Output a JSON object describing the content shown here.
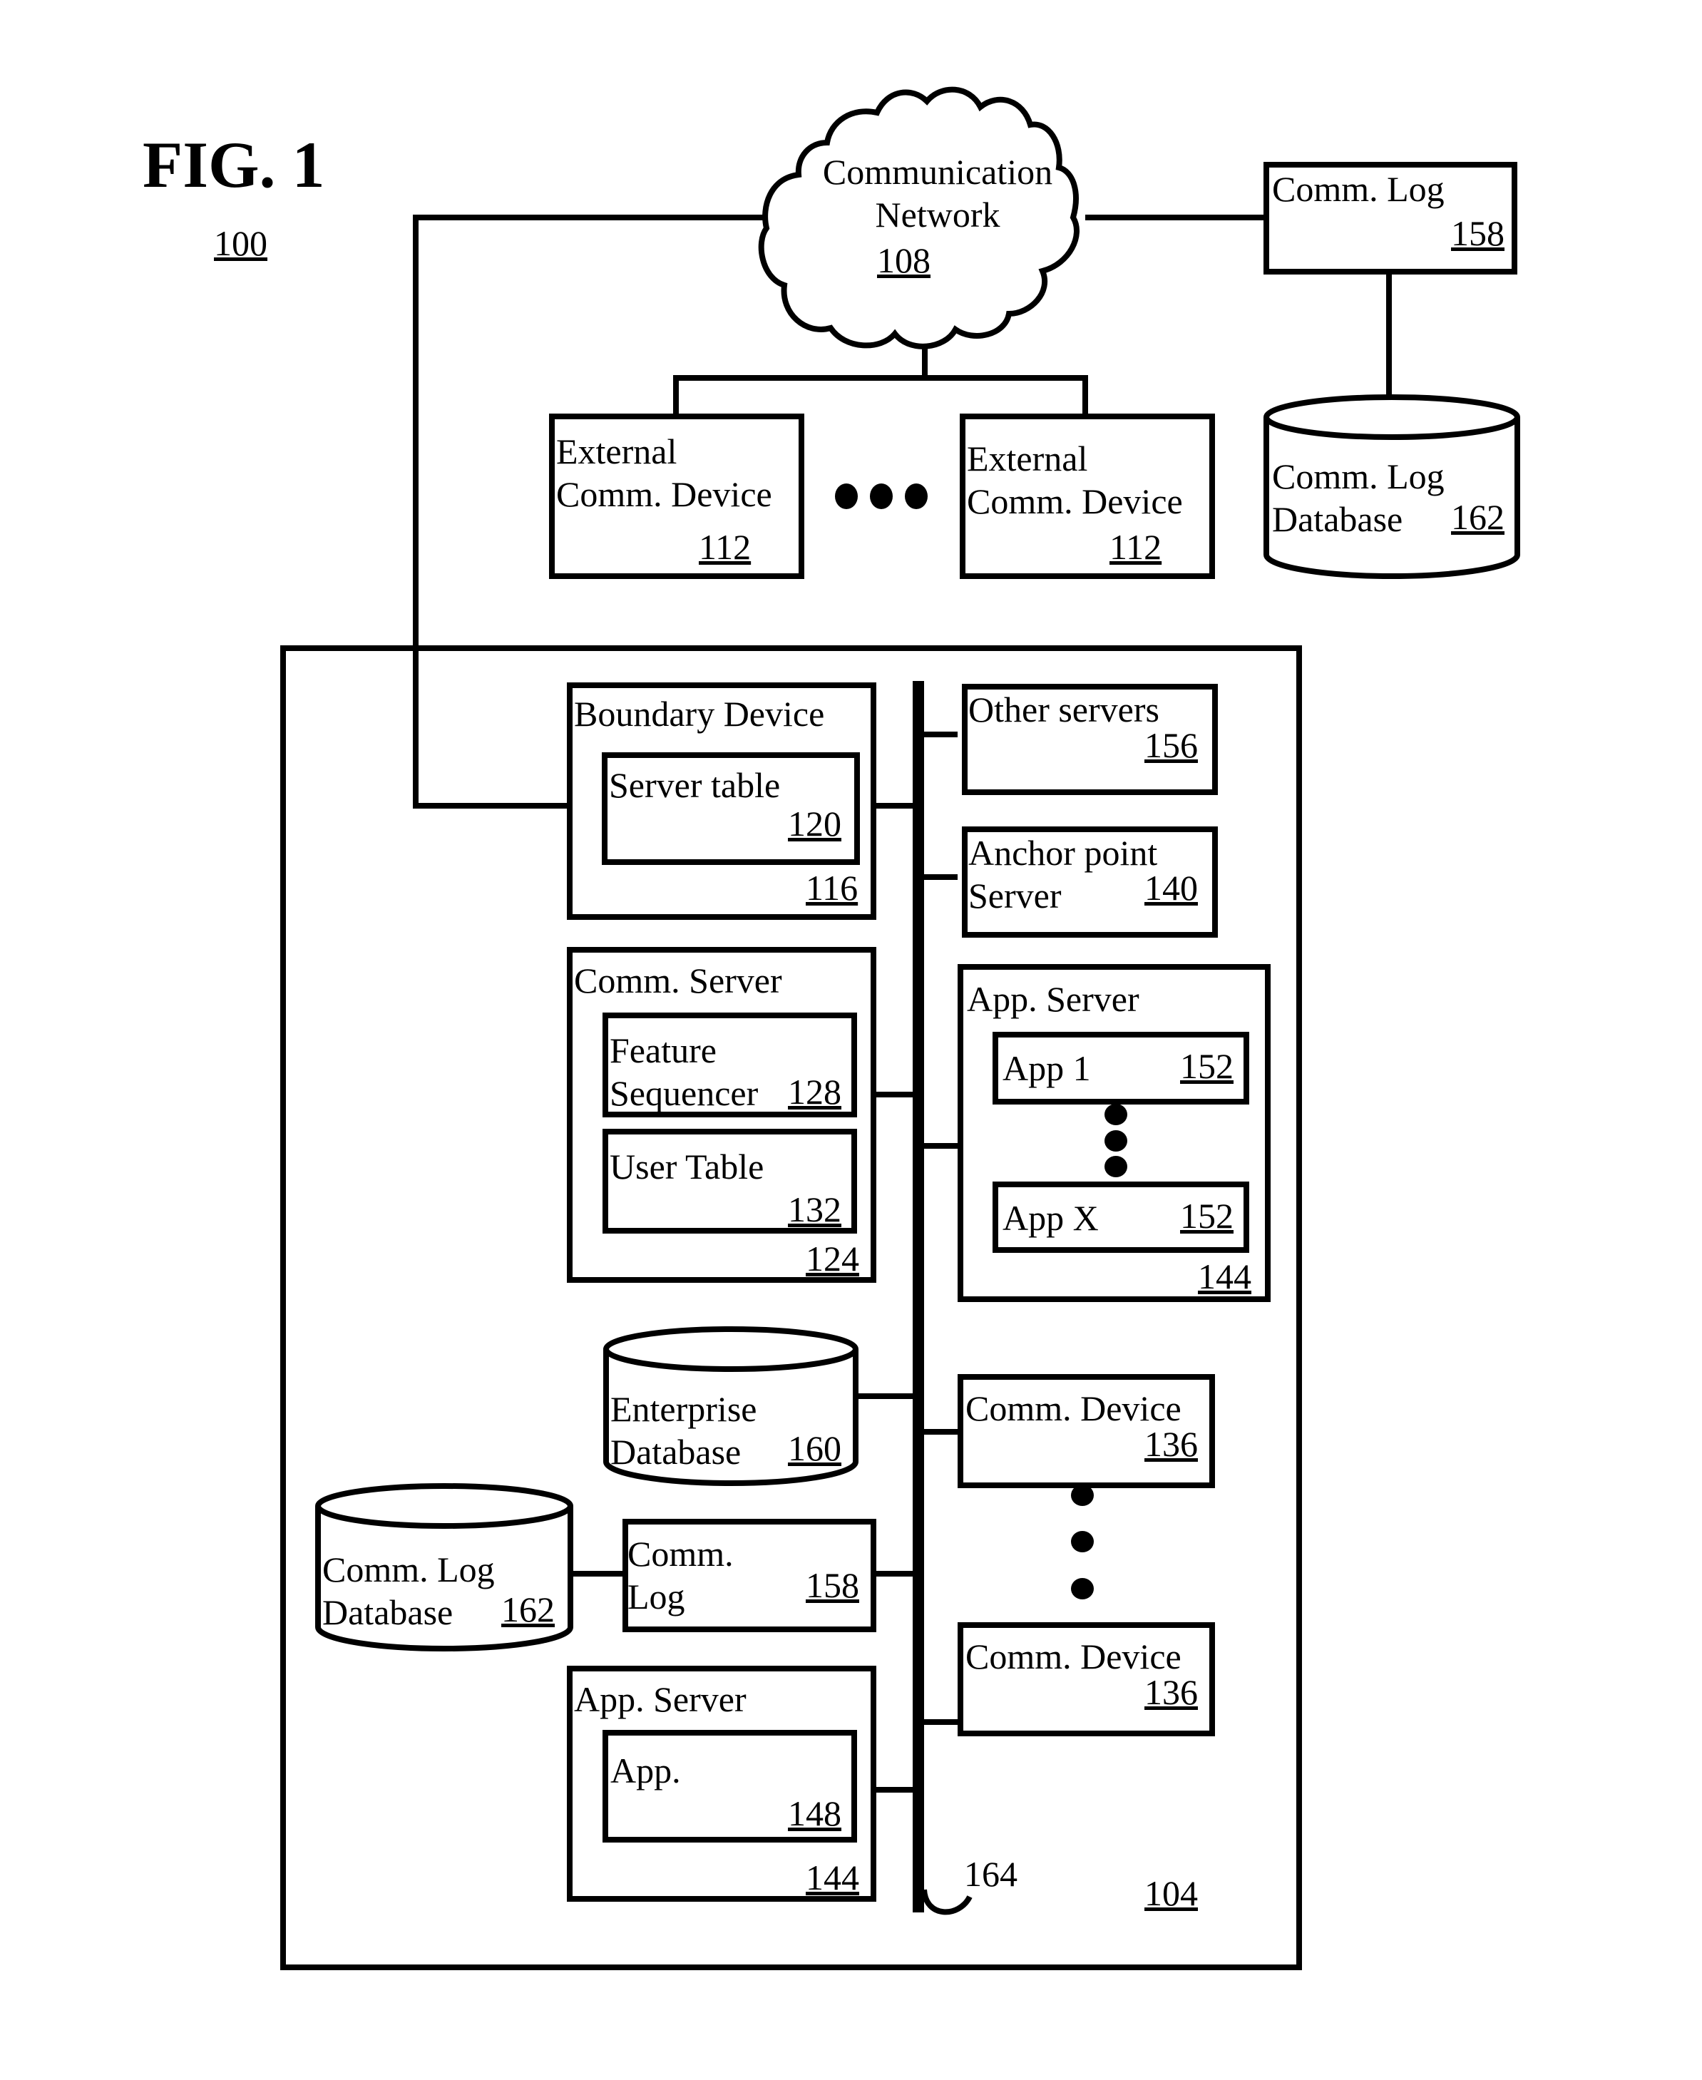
{
  "figure": {
    "title": "FIG. 1",
    "ref": "100"
  },
  "network": {
    "label_line1": "Communication",
    "label_line2": "Network",
    "ref": "108"
  },
  "external_devices": [
    {
      "label_line1": "External",
      "label_line2": "Comm. Device",
      "ref": "112"
    },
    {
      "label_line1": "External",
      "label_line2": "Comm. Device",
      "ref": "112"
    }
  ],
  "external_comm_log": {
    "label": "Comm. Log",
    "ref": "158"
  },
  "external_comm_log_db": {
    "label_line1": "Comm. Log",
    "label_line2": "Database",
    "ref": "162"
  },
  "enterprise": {
    "ref": "104",
    "bus_ref": "164",
    "boundary_device": {
      "label": "Boundary Device",
      "ref": "116",
      "server_table": {
        "label": "Server table",
        "ref": "120"
      }
    },
    "comm_server": {
      "label": "Comm. Server",
      "ref": "124",
      "feature_sequencer": {
        "label_line1": "Feature",
        "label_line2": "Sequencer",
        "ref": "128"
      },
      "user_table": {
        "label": "User Table",
        "ref": "132"
      }
    },
    "enterprise_db": {
      "label_line1": "Enterprise",
      "label_line2": "Database",
      "ref": "160"
    },
    "comm_log_db": {
      "label_line1": "Comm. Log",
      "label_line2": "Database",
      "ref": "162"
    },
    "comm_log": {
      "label_line1": "Comm.",
      "label_line2": "Log",
      "ref": "158"
    },
    "app_server_left": {
      "label": "App. Server",
      "ref": "144",
      "app": {
        "label": "App.",
        "ref": "148"
      }
    },
    "other_servers": {
      "label": "Other servers",
      "ref": "156"
    },
    "anchor_point_server": {
      "label_line1": "Anchor point",
      "label_line2": "Server",
      "ref": "140"
    },
    "app_server_right": {
      "label": "App. Server",
      "ref": "144",
      "apps": [
        {
          "label": "App 1",
          "ref": "152"
        },
        {
          "label": "App X",
          "ref": "152"
        }
      ]
    },
    "comm_devices": [
      {
        "label": "Comm. Device",
        "ref": "136"
      },
      {
        "label": "Comm. Device",
        "ref": "136"
      }
    ]
  }
}
